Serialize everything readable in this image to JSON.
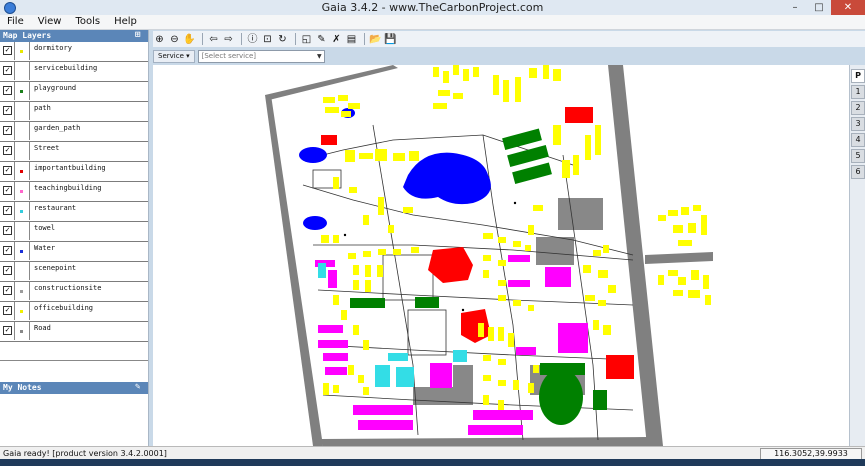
{
  "window": {
    "title": "Gaia 3.4.2 - www.TheCarbonProject.com",
    "minimize": "–",
    "maximize": "□",
    "close": "✕"
  },
  "menu": [
    "File",
    "View",
    "Tools",
    "Help"
  ],
  "layers_panel": {
    "title": "Map Layers",
    "layers": [
      {
        "name": "dormitory",
        "checked": true,
        "swatch": "#e8e800"
      },
      {
        "name": "servicebuilding",
        "checked": true,
        "swatch": "#ffffff"
      },
      {
        "name": "playground",
        "checked": true,
        "swatch": "#1a7f1a"
      },
      {
        "name": "path",
        "checked": true,
        "swatch": "#ffffff"
      },
      {
        "name": "garden_path",
        "checked": true,
        "swatch": "#ffffff"
      },
      {
        "name": "Street",
        "checked": true,
        "swatch": "#ffffff"
      },
      {
        "name": "importantbuilding",
        "checked": true,
        "swatch": "#e00000"
      },
      {
        "name": "teachingbuilding",
        "checked": true,
        "swatch": "#ff66cc"
      },
      {
        "name": "restaurant",
        "checked": true,
        "swatch": "#33ccdd"
      },
      {
        "name": "towel",
        "checked": true,
        "swatch": "#ffffff"
      },
      {
        "name": "Water",
        "checked": true,
        "swatch": "#1a2fd8"
      },
      {
        "name": "scenepoint",
        "checked": true,
        "swatch": "#ffffff"
      },
      {
        "name": "constructionsite",
        "checked": true,
        "swatch": "#9c9c9c"
      },
      {
        "name": "officebuilding",
        "checked": true,
        "swatch": "#f0f000"
      },
      {
        "name": "Road",
        "checked": true,
        "swatch": "#888888"
      }
    ]
  },
  "notes_panel": {
    "title": "My Notes"
  },
  "toolbar": {
    "icons": [
      "zoom-in-icon",
      "zoom-out-icon",
      "pan-icon",
      "back-icon",
      "forward-icon",
      "info-icon",
      "full-extent-icon",
      "refresh-icon",
      "add-layer-icon",
      "edit-icon",
      "clear-icon",
      "legend-icon",
      "open-icon",
      "save-icon"
    ],
    "glyphs": [
      "⊕",
      "⊖",
      "✋",
      "⇦",
      "⇨",
      "ⓘ",
      "⊡",
      "↻",
      "◱",
      "✎",
      "✗",
      "▤",
      "📂",
      "💾"
    ]
  },
  "service": {
    "button_label": "Service",
    "placeholder": "[Select service]"
  },
  "right_pager": {
    "header": "P",
    "pages": [
      "1",
      "2",
      "3",
      "4",
      "5",
      "6"
    ]
  },
  "status": {
    "message": "Gaia ready! [product version 3.4.2.0001]",
    "coordinates": "116.3052,39.9933"
  },
  "colors": {
    "dormitory": "#ffff00",
    "teaching": "#ff00ff",
    "important": "#ff0000",
    "restaurant": "#33dde6",
    "playground": "#008000",
    "water": "#0000ff",
    "construction": "#808080",
    "road": "#808080"
  }
}
